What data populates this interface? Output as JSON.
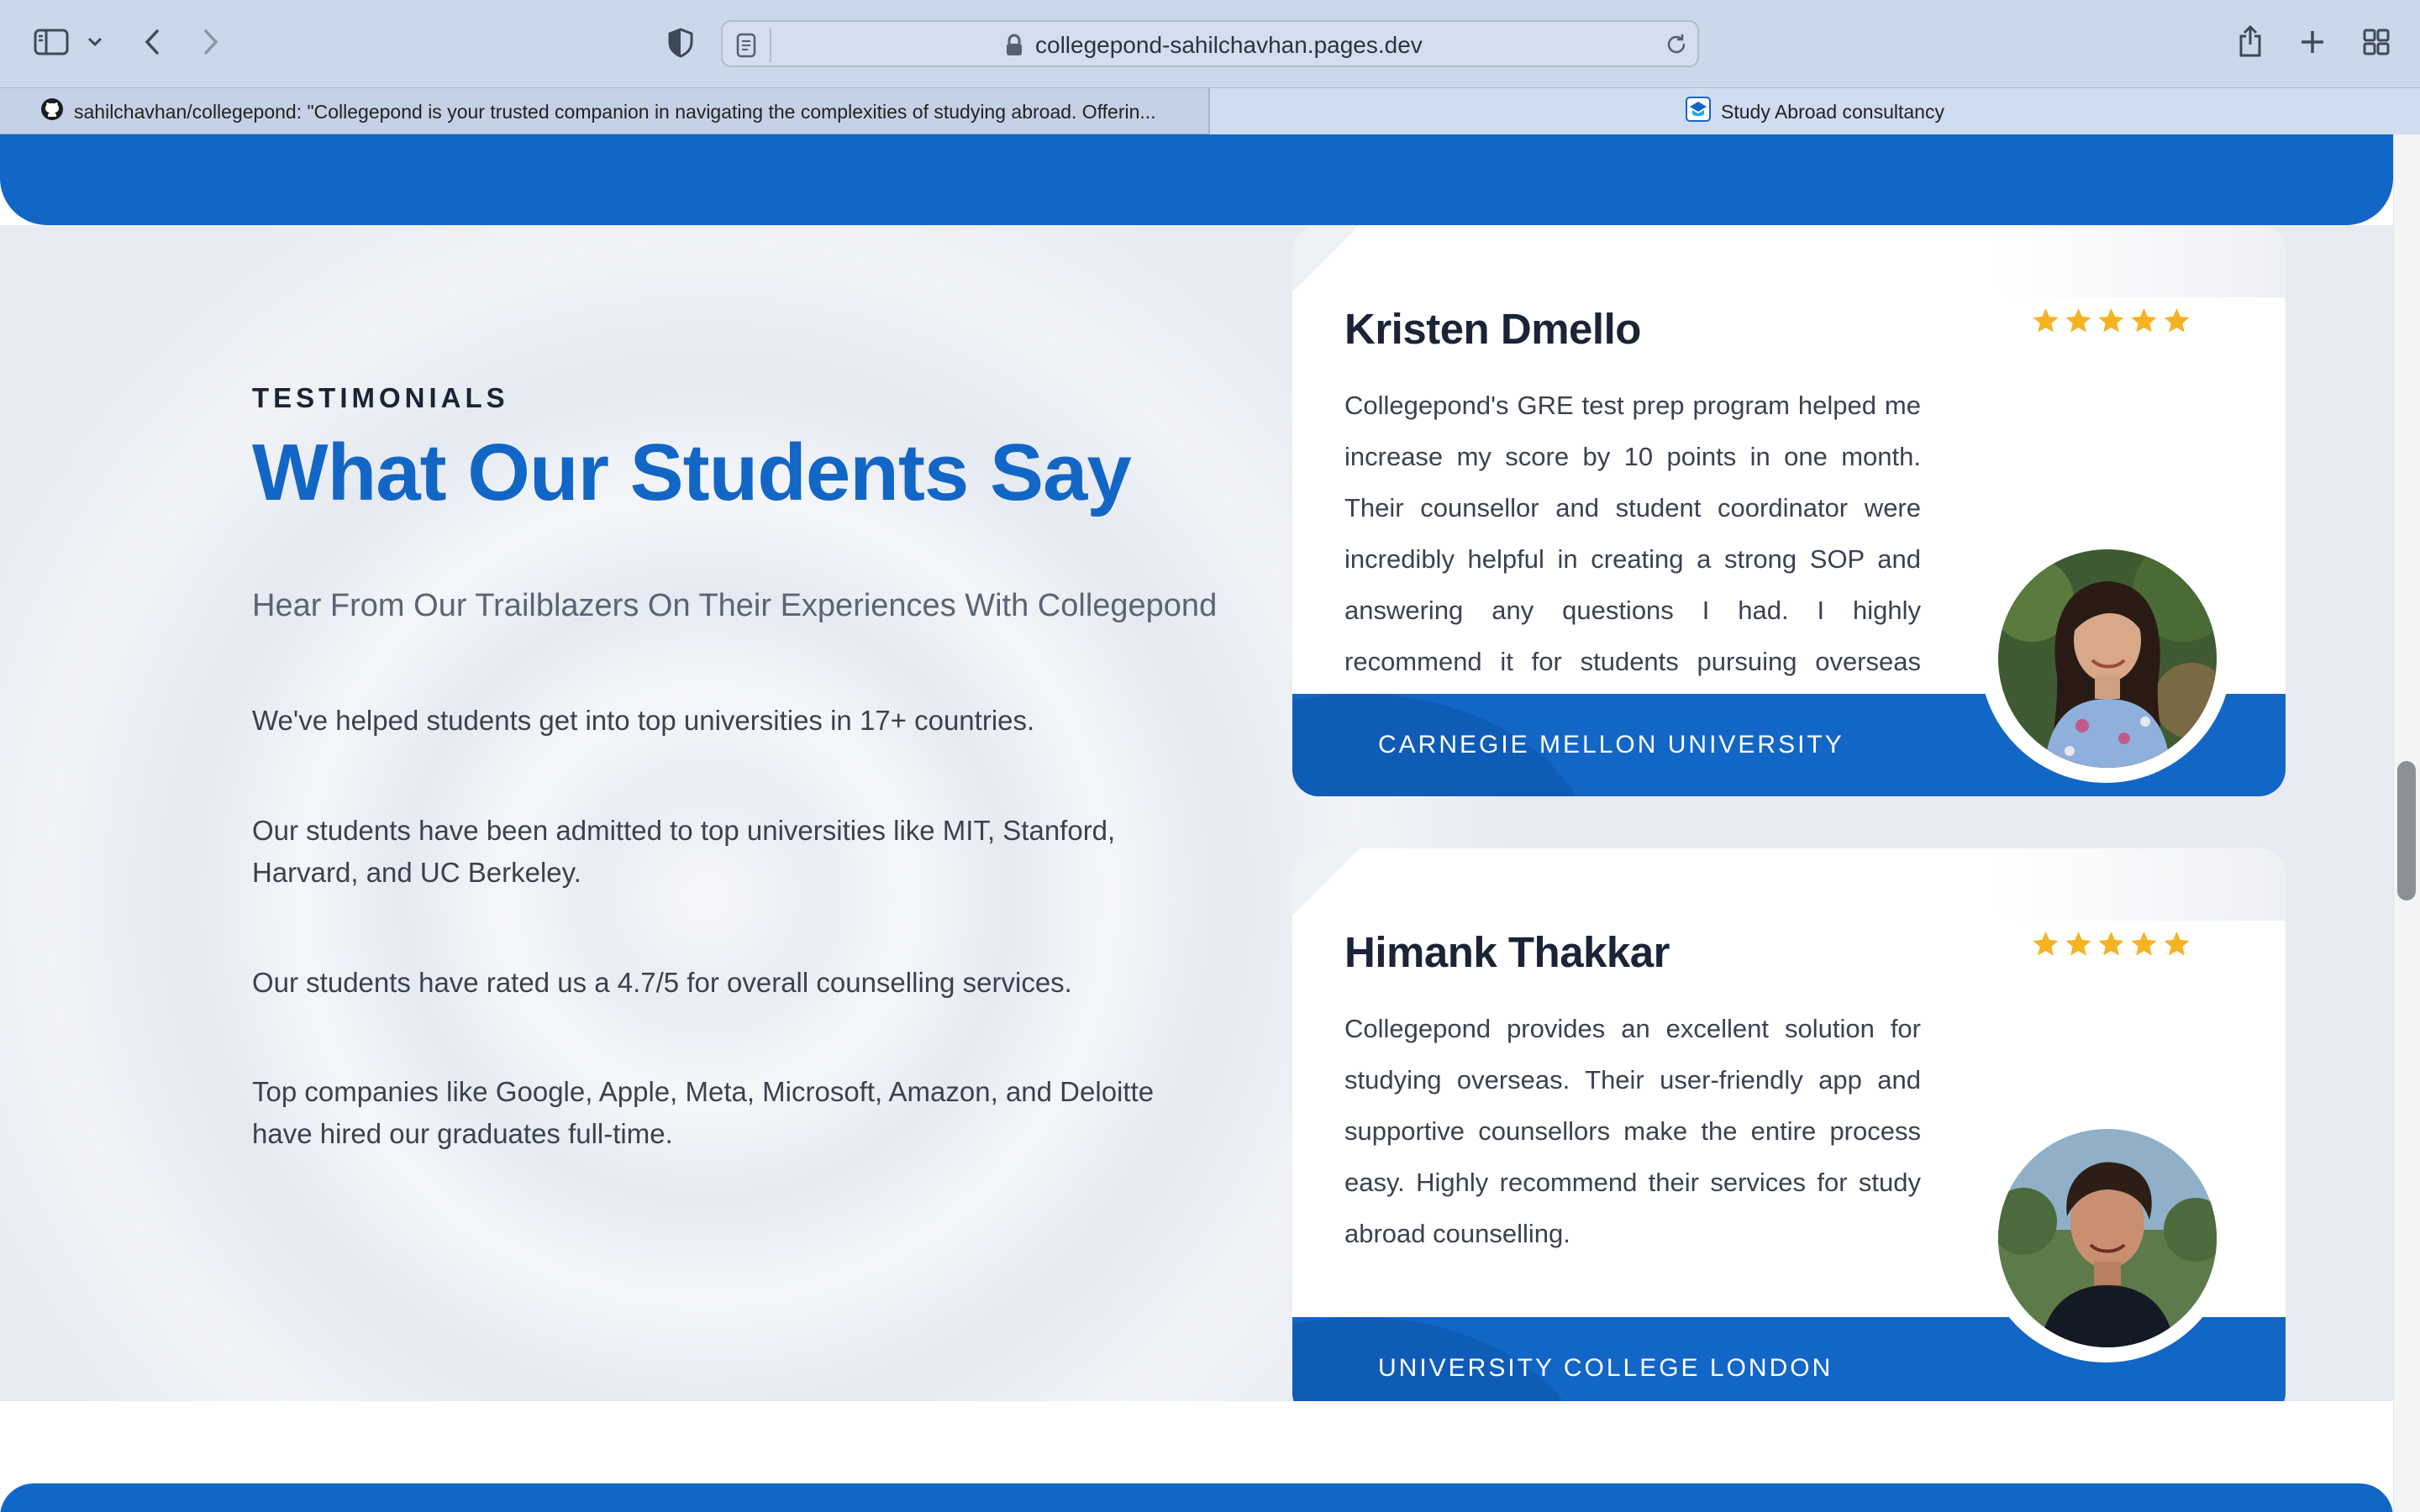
{
  "browser": {
    "url": "collegepond-sahilchavhan.pages.dev",
    "icons": {
      "sidebar": "sidebar-icon",
      "sidebar_menu": "chevron-down-icon",
      "back": "chevron-left-icon",
      "forward": "chevron-right-icon",
      "privacy": "shield-icon",
      "reader": "reader-icon",
      "lock": "lock-icon",
      "reload": "reload-icon",
      "share": "share-icon",
      "new_tab": "plus-icon",
      "tab_overview": "grid-icon"
    },
    "tabs": [
      {
        "title": "sahilchavhan/collegepond: \"Collegepond is your trusted companion in navigating the complexities of studying abroad. Offerin...",
        "icon": "github-icon",
        "active": false
      },
      {
        "title": "Study Abroad consultancy",
        "icon": "collegepond-logo-icon",
        "active": true
      }
    ]
  },
  "testimonials": {
    "eyebrow": "TESTIMONIALS",
    "heading": "What Our Students Say",
    "subheading": "Hear From Our Trailblazers On Their Experiences With Collegepond",
    "points": [
      "We've helped students get into top universities in 17+ countries.",
      "Our students have been admitted to top universities like MIT, Stanford, Harvard, and UC Berkeley.",
      "Our students have rated us a 4.7/5 for overall counselling services.",
      "Top companies like Google, Apple, Meta, Microsoft, Amazon, and Deloitte have hired our graduates full-time."
    ],
    "cards": [
      {
        "name": "Kristen Dmello",
        "rating": 5,
        "rating_max": 5,
        "quote": "Collegepond's GRE test prep program helped me increase my score by 10 points in one month. Their counsellor and student coordinator were incredibly helpful in creating a strong SOP and answering any questions I had. I highly recommend it for students pursuing overseas education.",
        "university": "CARNEGIE MELLON UNIVERSITY"
      },
      {
        "name": "Himank Thakkar",
        "rating": 5,
        "rating_max": 5,
        "quote": "Collegepond provides an excellent solution for studying overseas. Their user-friendly app and supportive counsellors make the entire process easy. Highly recommend their services for study abroad counselling.",
        "university": "UNIVERSITY COLLEGE LONDON"
      }
    ]
  },
  "colors": {
    "brand_blue": "#1266c6",
    "heading_dark": "#1b2436",
    "star": "#f5b324",
    "toolbar": "#cbd8ec"
  }
}
